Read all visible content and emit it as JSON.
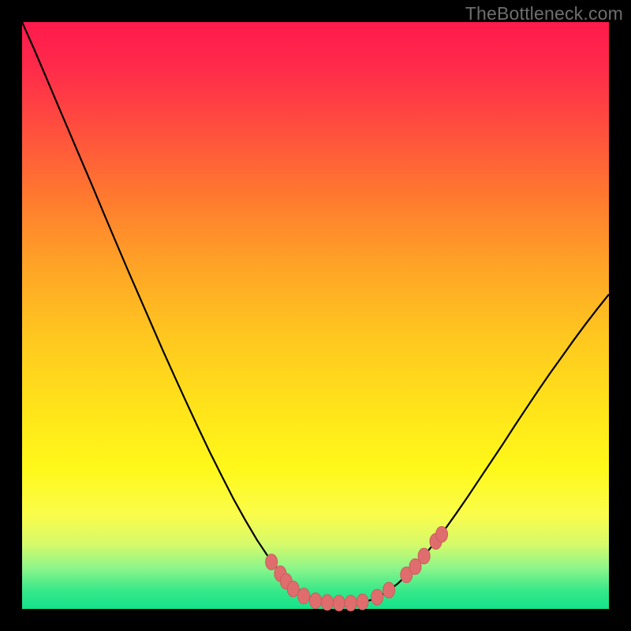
{
  "watermark": "TheBottleneck.com",
  "colors": {
    "frame": "#000000",
    "curve_stroke": "#000000",
    "marker_fill": "#e06d6d",
    "marker_stroke": "#c95d5d",
    "gradient_top": "#ff1a4d",
    "gradient_bottom": "#14e28b"
  },
  "chart_data": {
    "type": "line",
    "title": "",
    "xlabel": "",
    "ylabel": "",
    "xlim": [
      0,
      100
    ],
    "ylim": [
      0,
      100
    ],
    "x": [
      0,
      2,
      4,
      6,
      8,
      10,
      12,
      14,
      16,
      18,
      20,
      22,
      24,
      26,
      28,
      30,
      32,
      34,
      36,
      38,
      40,
      42,
      44,
      46,
      48,
      50,
      52,
      54,
      56,
      58,
      60,
      62,
      64,
      66,
      68,
      70,
      72,
      74,
      76,
      78,
      80,
      82,
      84,
      86,
      88,
      90,
      92,
      94,
      96,
      98,
      100
    ],
    "y": [
      100,
      95.5,
      90.8,
      86.1,
      81.4,
      76.7,
      72.0,
      67.2,
      62.5,
      57.8,
      53.2,
      48.6,
      44.0,
      39.6,
      35.2,
      30.9,
      26.7,
      22.7,
      18.8,
      15.2,
      11.8,
      8.8,
      6.2,
      4.1,
      2.6,
      1.6,
      1.1,
      1.0,
      1.0,
      1.1,
      1.7,
      2.8,
      4.3,
      6.2,
      8.4,
      10.9,
      13.5,
      16.3,
      19.2,
      22.2,
      25.2,
      28.2,
      31.3,
      34.3,
      37.3,
      40.2,
      43.0,
      45.8,
      48.5,
      51.1,
      53.6
    ],
    "markers": [
      {
        "x": 42.5,
        "y": 8.0
      },
      {
        "x": 44.0,
        "y": 6.0
      },
      {
        "x": 45.0,
        "y": 4.7
      },
      {
        "x": 46.2,
        "y": 3.4
      },
      {
        "x": 48.0,
        "y": 2.2
      },
      {
        "x": 50.0,
        "y": 1.4
      },
      {
        "x": 52.0,
        "y": 1.1
      },
      {
        "x": 54.0,
        "y": 1.0
      },
      {
        "x": 56.0,
        "y": 1.0
      },
      {
        "x": 58.0,
        "y": 1.2
      },
      {
        "x": 60.5,
        "y": 2.0
      },
      {
        "x": 62.5,
        "y": 3.2
      },
      {
        "x": 65.5,
        "y": 5.8
      },
      {
        "x": 67.0,
        "y": 7.2
      },
      {
        "x": 68.5,
        "y": 9.0
      },
      {
        "x": 70.5,
        "y": 11.5
      },
      {
        "x": 71.5,
        "y": 12.7
      }
    ],
    "note": "No axis ticks or numeric labels are rendered in the image; x/y are normalized 0–100 estimates read from curve geometry."
  }
}
